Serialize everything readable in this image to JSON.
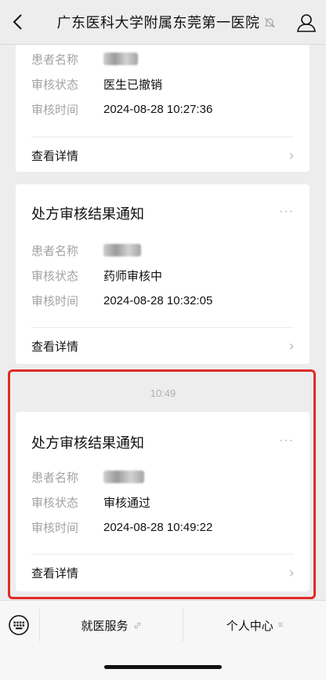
{
  "header": {
    "title": "广东医科大学附属东莞第一医院"
  },
  "cards": [
    {
      "title": "",
      "rows": [
        {
          "label": "患者名称",
          "value": ""
        },
        {
          "label": "审核状态",
          "value": "医生已撤销"
        },
        {
          "label": "审核时间",
          "value": "2024-08-28 10:27:36"
        }
      ],
      "detail_label": "查看详情"
    },
    {
      "title": "处方审核结果通知",
      "rows": [
        {
          "label": "患者名称",
          "value": ""
        },
        {
          "label": "审核状态",
          "value": "药师审核中"
        },
        {
          "label": "审核时间",
          "value": "2024-08-28 10:32:05"
        }
      ],
      "detail_label": "查看详情"
    },
    {
      "title": "处方审核结果通知",
      "rows": [
        {
          "label": "患者名称",
          "value": ""
        },
        {
          "label": "审核状态",
          "value": "审核通过"
        },
        {
          "label": "审核时间",
          "value": "2024-08-28 10:49:22"
        }
      ],
      "detail_label": "查看详情"
    }
  ],
  "timestamp": "10:49",
  "more_glyph": "···",
  "chevron_glyph": "›",
  "tabbar": {
    "menu1": "就医服务",
    "menu2": "个人中心",
    "menu2_icon": "≡"
  },
  "colors": {
    "highlight": "#e02b25",
    "background": "#ededed"
  }
}
